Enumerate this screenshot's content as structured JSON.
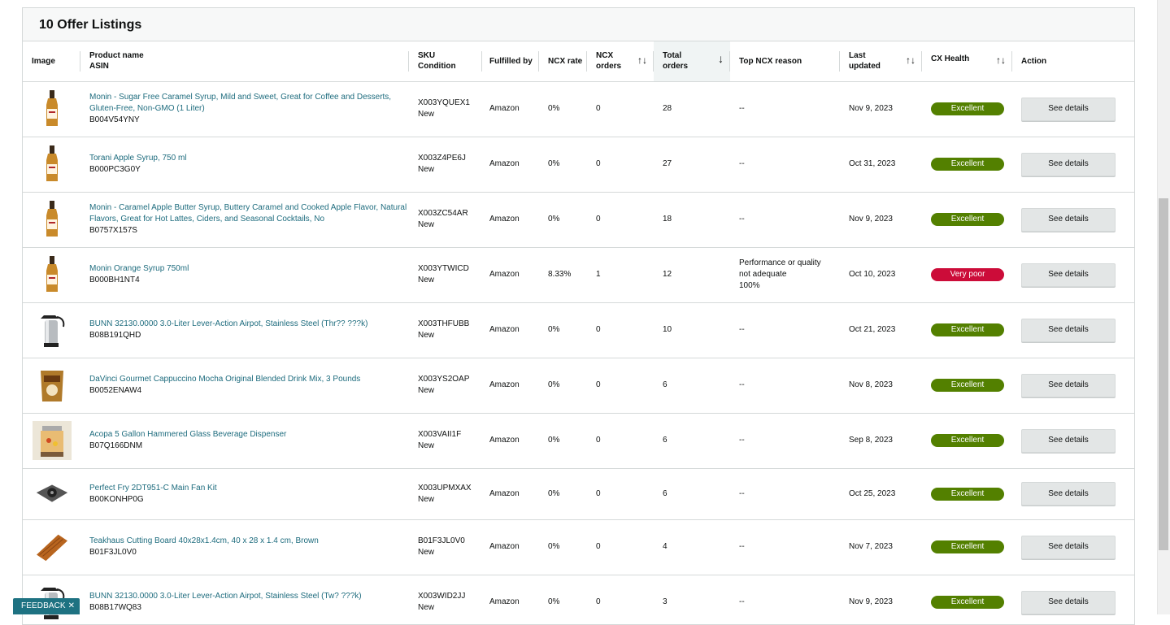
{
  "title": "10 Offer Listings",
  "feedback_label": "FEEDBACK ✕",
  "columns": {
    "image": "Image",
    "product_name": "Product name",
    "asin": "ASIN",
    "sku": "SKU",
    "condition": "Condition",
    "fulfilled_by": "Fulfilled by",
    "ncx_rate": "NCX rate",
    "ncx_orders_1": "NCX",
    "ncx_orders_2": "orders",
    "total_orders_1": "Total",
    "total_orders_2": "orders",
    "top_ncx_reason": "Top NCX reason",
    "last_updated_1": "Last",
    "last_updated_2": "updated",
    "cx_health": "CX Health",
    "action": "Action",
    "sort_both_icon": "↑↓",
    "sort_down_icon": "↓"
  },
  "colors": {
    "link": "#1e6c7e",
    "excellent": "#538000",
    "very_poor": "#cc0c39"
  },
  "rows": [
    {
      "image_icon": "syrup-bottle-icon",
      "name": "Monin - Sugar Free Caramel Syrup, Mild and Sweet, Great for Coffee and Desserts, Gluten-Free, Non-GMO (1 Liter)",
      "asin": "B004V54YNY",
      "sku": "X003YQUEX1",
      "condition": "New",
      "fulfilled_by": "Amazon",
      "ncx_rate": "0%",
      "ncx_orders": "0",
      "total_orders": "28",
      "reason_1": "--",
      "reason_2": "",
      "reason_3": "",
      "last_updated": "Nov 9, 2023",
      "health": "Excellent",
      "action": "See details"
    },
    {
      "image_icon": "syrup-bottle-icon",
      "name": "Torani Apple Syrup, 750 ml",
      "asin": "B000PC3G0Y",
      "sku": "X003Z4PE6J",
      "condition": "New",
      "fulfilled_by": "Amazon",
      "ncx_rate": "0%",
      "ncx_orders": "0",
      "total_orders": "27",
      "reason_1": "--",
      "reason_2": "",
      "reason_3": "",
      "last_updated": "Oct 31, 2023",
      "health": "Excellent",
      "action": "See details"
    },
    {
      "image_icon": "syrup-bottle-icon",
      "name": "Monin - Caramel Apple Butter Syrup, Buttery Caramel and Cooked Apple Flavor, Natural Flavors, Great for Hot Lattes, Ciders, and Seasonal Cocktails, No",
      "asin": "B0757X157S",
      "sku": "X003ZC54AR",
      "condition": "New",
      "fulfilled_by": "Amazon",
      "ncx_rate": "0%",
      "ncx_orders": "0",
      "total_orders": "18",
      "reason_1": "--",
      "reason_2": "",
      "reason_3": "",
      "last_updated": "Nov 9, 2023",
      "health": "Excellent",
      "action": "See details"
    },
    {
      "image_icon": "syrup-bottle-icon",
      "name": "Monin Orange Syrup 750ml",
      "asin": "B000BH1NT4",
      "sku": "X003YTWICD",
      "condition": "New",
      "fulfilled_by": "Amazon",
      "ncx_rate": "8.33%",
      "ncx_orders": "1",
      "total_orders": "12",
      "reason_1": "Performance or quality",
      "reason_2": "not adequate",
      "reason_3": "100%",
      "last_updated": "Oct 10, 2023",
      "health": "Very poor",
      "action": "See details"
    },
    {
      "image_icon": "airpot-icon",
      "name": "BUNN 32130.0000 3.0-Liter Lever-Action Airpot, Stainless Steel (Thr?? ???k)",
      "asin": "B08B191QHD",
      "sku": "X003THFUBB",
      "condition": "New",
      "fulfilled_by": "Amazon",
      "ncx_rate": "0%",
      "ncx_orders": "0",
      "total_orders": "10",
      "reason_1": "--",
      "reason_2": "",
      "reason_3": "",
      "last_updated": "Oct 21, 2023",
      "health": "Excellent",
      "action": "See details"
    },
    {
      "image_icon": "drink-mix-pouch-icon",
      "name": "DaVinci Gourmet Cappuccino Mocha Original Blended Drink Mix, 3 Pounds",
      "asin": "B0052ENAW4",
      "sku": "X003YS2OAP",
      "condition": "New",
      "fulfilled_by": "Amazon",
      "ncx_rate": "0%",
      "ncx_orders": "0",
      "total_orders": "6",
      "reason_1": "--",
      "reason_2": "",
      "reason_3": "",
      "last_updated": "Nov 8, 2023",
      "health": "Excellent",
      "action": "See details"
    },
    {
      "image_icon": "beverage-dispenser-icon",
      "name": "Acopa 5 Gallon Hammered Glass Beverage Dispenser",
      "asin": "B07Q166DNM",
      "sku": "X003VAII1F",
      "condition": "New",
      "fulfilled_by": "Amazon",
      "ncx_rate": "0%",
      "ncx_orders": "0",
      "total_orders": "6",
      "reason_1": "--",
      "reason_2": "",
      "reason_3": "",
      "last_updated": "Sep 8, 2023",
      "health": "Excellent",
      "action": "See details"
    },
    {
      "image_icon": "fan-kit-icon",
      "name": "Perfect Fry 2DT951-C Main Fan Kit",
      "asin": "B00KONHP0G",
      "sku": "X003UPMXAX",
      "condition": "New",
      "fulfilled_by": "Amazon",
      "ncx_rate": "0%",
      "ncx_orders": "0",
      "total_orders": "6",
      "reason_1": "--",
      "reason_2": "",
      "reason_3": "",
      "last_updated": "Oct 25, 2023",
      "health": "Excellent",
      "action": "See details"
    },
    {
      "image_icon": "cutting-board-icon",
      "name": "Teakhaus Cutting Board 40x28x1.4cm, 40 x 28 x 1.4 cm, Brown",
      "asin": "B01F3JL0V0",
      "sku": "B01F3JL0V0",
      "condition": "New",
      "fulfilled_by": "Amazon",
      "ncx_rate": "0%",
      "ncx_orders": "0",
      "total_orders": "4",
      "reason_1": "--",
      "reason_2": "",
      "reason_3": "",
      "last_updated": "Nov 7, 2023",
      "health": "Excellent",
      "action": "See details"
    },
    {
      "image_icon": "airpot-icon",
      "name": "BUNN 32130.0000 3.0-Liter Lever-Action Airpot, Stainless Steel (Tw? ???k)",
      "asin": "B08B17WQ83",
      "sku": "X003WID2JJ",
      "condition": "New",
      "fulfilled_by": "Amazon",
      "ncx_rate": "0%",
      "ncx_orders": "0",
      "total_orders": "3",
      "reason_1": "--",
      "reason_2": "",
      "reason_3": "",
      "last_updated": "Nov 9, 2023",
      "health": "Excellent",
      "action": "See details"
    }
  ]
}
